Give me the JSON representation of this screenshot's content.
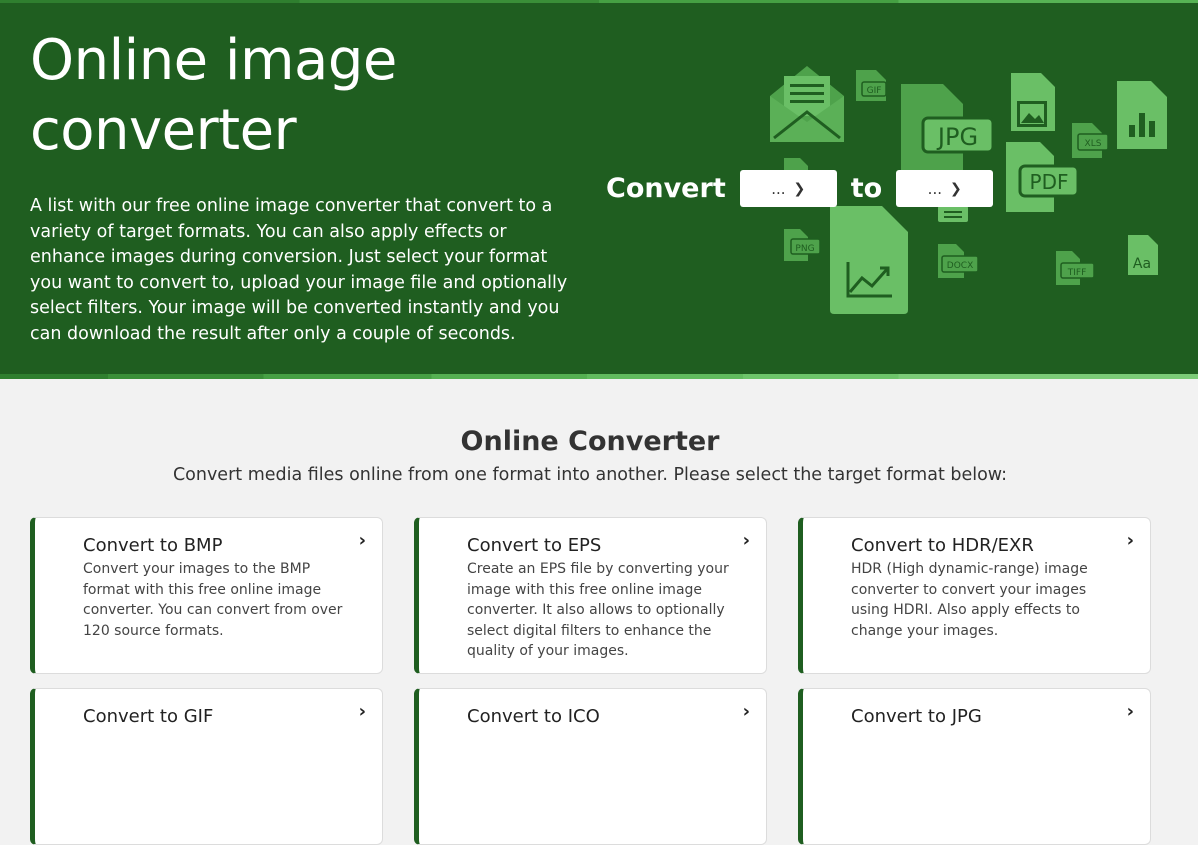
{
  "hero": {
    "title": "Online image converter",
    "description": "A list with our free online image converter that convert to a variety of target formats. You can also apply effects or enhance images during conversion. Just select your format you want to convert to, upload your image file and optionally select filters. Your image will be converted instantly and you can download the result after only a couple of seconds.",
    "convert_label": "Convert",
    "to_label": "to",
    "from_select": "...",
    "to_select": "...",
    "icons": [
      {
        "name": "envelope-icon"
      },
      {
        "name": "gif-file-icon",
        "label": "GIF"
      },
      {
        "name": "jpg-file-icon",
        "label": "JPG"
      },
      {
        "name": "image-file-icon"
      },
      {
        "name": "xls-file-icon",
        "label": "XLS"
      },
      {
        "name": "chart-file-icon"
      },
      {
        "name": "pdf-file-icon",
        "label": "PDF"
      },
      {
        "name": "png-file-icon",
        "label": "PNG"
      },
      {
        "name": "graph-file-icon"
      },
      {
        "name": "docx-file-icon",
        "label": "DOCX"
      },
      {
        "name": "tiff-file-icon",
        "label": "TIFF"
      },
      {
        "name": "font-file-icon",
        "label": "Aa"
      }
    ]
  },
  "section": {
    "title": "Online Converter",
    "subtitle": "Convert media files online from one format into another. Please select the target format below:"
  },
  "cards": [
    {
      "title": "Convert to BMP",
      "desc": "Convert your images to the BMP format with this free online image converter. You can convert from over 120 source formats."
    },
    {
      "title": "Convert to EPS",
      "desc": "Create an EPS file by converting your image with this free online image converter. It also allows to optionally select digital filters to enhance the quality of your images."
    },
    {
      "title": "Convert to HDR/EXR",
      "desc": "HDR (High dynamic-range) image converter to convert your images using HDRI. Also apply effects to change your images."
    },
    {
      "title": "Convert to GIF",
      "desc": ""
    },
    {
      "title": "Convert to ICO",
      "desc": ""
    },
    {
      "title": "Convert to JPG",
      "desc": ""
    }
  ],
  "colors": {
    "hero_bg": "#1f5e20",
    "icon_light": "#6abf66",
    "icon_mid": "#4ea24b",
    "accent": "#1f5e20"
  }
}
